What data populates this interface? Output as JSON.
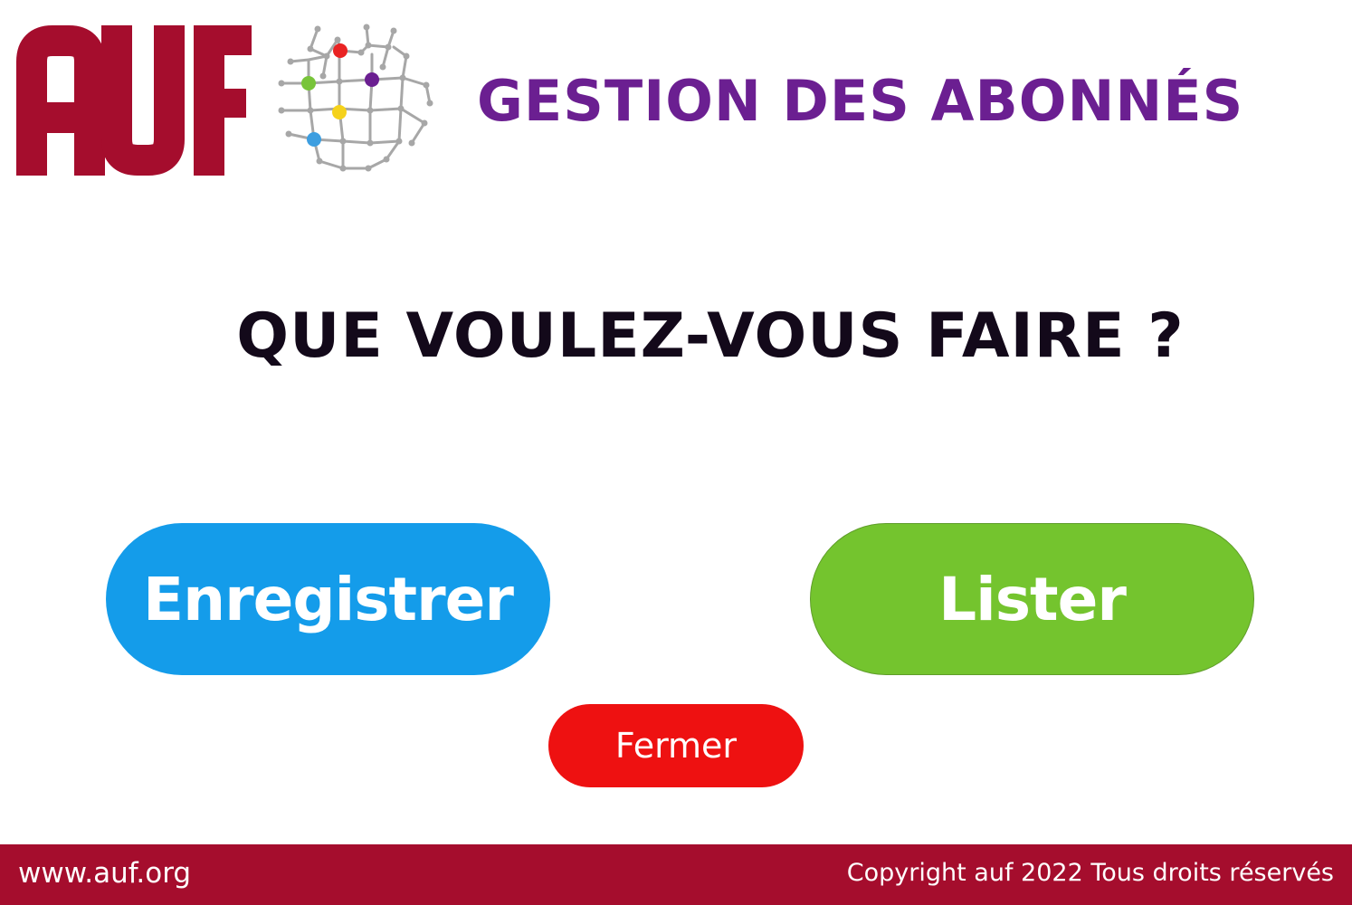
{
  "header": {
    "logo_text": "AUF",
    "title": "GESTION DES ABONNÉS"
  },
  "main": {
    "prompt": "QUE VOULEZ-VOUS FAIRE ?",
    "register_label": "Enregistrer",
    "list_label": "Lister",
    "close_label": "Fermer"
  },
  "footer": {
    "website": "www.auf.org",
    "copyright": "Copyright auf 2022 Tous droits réservés"
  },
  "colors": {
    "brand_red": "#a50d2d",
    "title_purple": "#6b1f91",
    "register_blue": "#149cea",
    "list_green": "#74c42e",
    "close_red": "#ee1111"
  },
  "icons": {
    "logo": "auf-logo",
    "globe": "network-globe-icon"
  }
}
